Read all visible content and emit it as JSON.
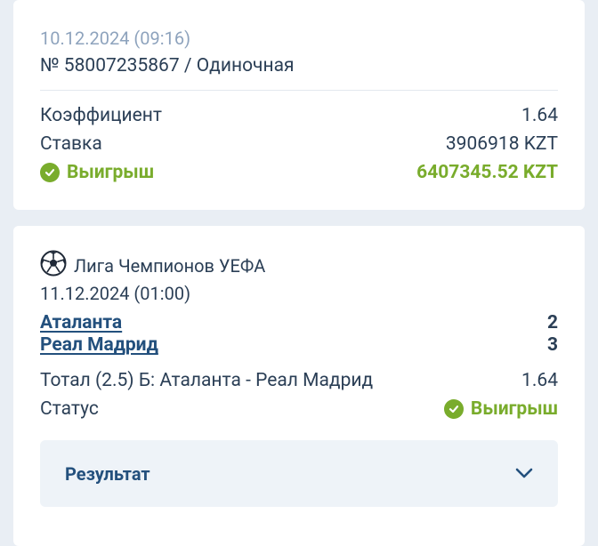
{
  "bet": {
    "datetime": "10.12.2024 (09:16)",
    "number": "№ 58007235867 / Одиночная",
    "coef_label": "Коэффициент",
    "coef_value": "1.64",
    "stake_label": "Ставка",
    "stake_value": "3906918 KZT",
    "win_label": "Выигрыш",
    "win_value": "6407345.52 KZT"
  },
  "event": {
    "league_icon": "soccer-ball-icon",
    "league": "Лига Чемпионов УЕФА",
    "datetime": "11.12.2024 (01:00)",
    "team1": "Аталанта",
    "score1": "2",
    "team2": "Реал Мадрид",
    "score2": "3",
    "market": "Тотал (2.5) Б: Аталанта - Реал Мадрид",
    "market_odds": "1.64",
    "status_label": "Статус",
    "status_value": "Выигрыш",
    "result_label": "Результат"
  },
  "colors": {
    "win": "#79ac2c",
    "link": "#23507d",
    "muted": "#8ea3bd"
  }
}
